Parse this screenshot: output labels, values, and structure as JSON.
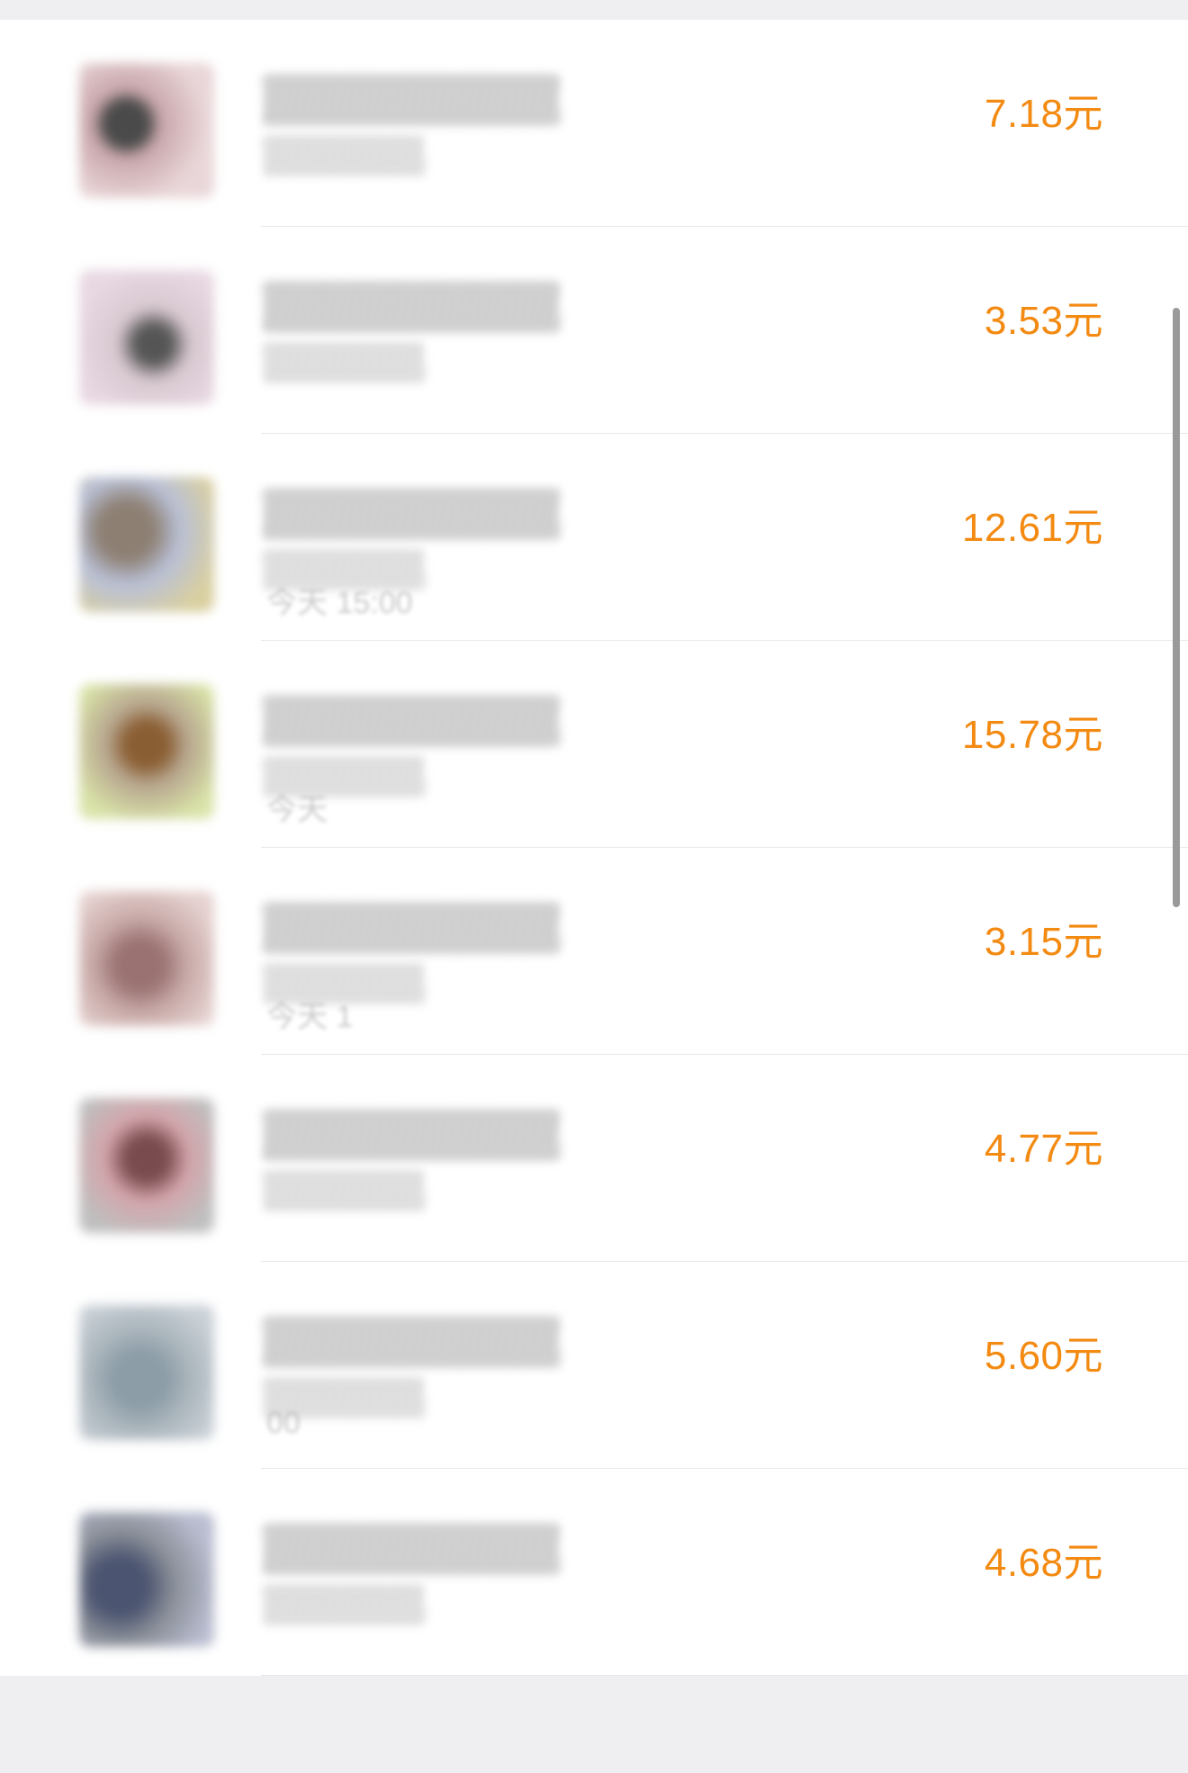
{
  "transactions": [
    {
      "amount": "7.18元",
      "time": "",
      "thumb_colors": [
        "#c9a7ab",
        "#4a4a4a",
        "#e9d6d8"
      ]
    },
    {
      "amount": "3.53元",
      "time": "",
      "thumb_colors": [
        "#e8d8e2",
        "#555555",
        "#d8c8d0"
      ]
    },
    {
      "amount": "12.61元",
      "time": "今天 15:00",
      "thumb_colors": [
        "#8d7f72",
        "#b9c0d6",
        "#d9cfa0"
      ]
    },
    {
      "amount": "15.78元",
      "time": "今天",
      "thumb_colors": [
        "#8a5e33",
        "#d9e3a8",
        "#b7a68f"
      ]
    },
    {
      "amount": "3.15元",
      "time": "今天 1",
      "thumb_colors": [
        "#9a7272",
        "#e5d2d0",
        "#c8aaa8"
      ]
    },
    {
      "amount": "4.77元",
      "time": "",
      "thumb_colors": [
        "#7a4b4e",
        "#d3a5ab",
        "#bfbfbf"
      ]
    },
    {
      "amount": "5.60元",
      "time": "00",
      "thumb_colors": [
        "#8c9da8",
        "#c9d0d6",
        "#a8b3ba"
      ]
    },
    {
      "amount": "4.68元",
      "time": "",
      "thumb_colors": [
        "#4b5470",
        "#b9bdd0",
        "#8a8f98"
      ]
    }
  ],
  "colors": {
    "amount": "#f38a12",
    "background": "#efeff2",
    "card": "#ffffff",
    "divider": "#e8e8ea"
  }
}
